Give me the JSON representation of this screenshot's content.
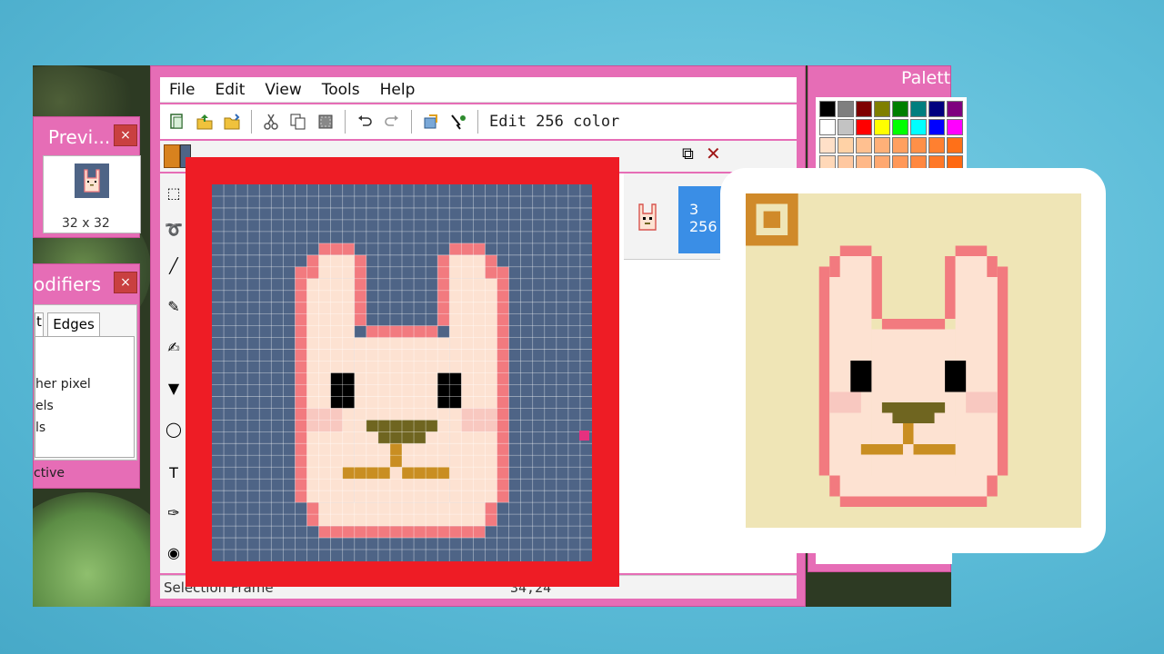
{
  "main": {
    "menu": [
      "File",
      "Edit",
      "View",
      "Tools",
      "Help"
    ],
    "toolbar": {
      "icons": [
        "new-icon",
        "open-icon",
        "folder-icon",
        "cut-icon",
        "copy-icon",
        "paste-icon",
        "undo-icon",
        "redo-icon",
        "image-icon",
        "picker-icon"
      ],
      "mode_label": "Edit 256 color"
    },
    "status": {
      "left": "Selection Frame",
      "coords": "34,24"
    },
    "thumbnail": {
      "label_top": "3",
      "label_bottom": "256"
    }
  },
  "preview_panel": {
    "title": "Previ...",
    "size_label": "32 x 32",
    "close": "×"
  },
  "modifiers_panel": {
    "title": "odifiers",
    "close": "×",
    "tabs": [
      "t",
      "Edges"
    ],
    "lines": [
      "her pixel",
      "els",
      "ls"
    ],
    "footer": "ctive"
  },
  "palette_panel": {
    "title": "Palett",
    "colors": [
      "#000000",
      "#7f7f7f",
      "#7f0000",
      "#7f7f00",
      "#007f00",
      "#007f7f",
      "#00007f",
      "#7f007f",
      "#ffffff",
      "#c3c3c3",
      "#ff0000",
      "#ffff00",
      "#00ff00",
      "#00ffff",
      "#0000ff",
      "#ff00ff",
      "#ffe0c8",
      "#ffd2a6",
      "#ffc090",
      "#ffb078",
      "#ffa060",
      "#ff9048",
      "#ff8030",
      "#ff7018",
      "#ffd8b8",
      "#ffc8a0",
      "#ffb888",
      "#ffa870",
      "#ff9858",
      "#ff8840",
      "#ff7828",
      "#ff6810"
    ]
  },
  "colors": {
    "canvas_bg": "#4e6486",
    "bunny_fill": "#fde2d2",
    "bunny_outline": "#f27a7f",
    "eyes": "#000000",
    "nose": "#6f6520",
    "mouth": "#c98e22",
    "cheek": "#f8c8c0",
    "highlight_frame": "#ee1c25",
    "preview_bg": "#efe5b6"
  }
}
